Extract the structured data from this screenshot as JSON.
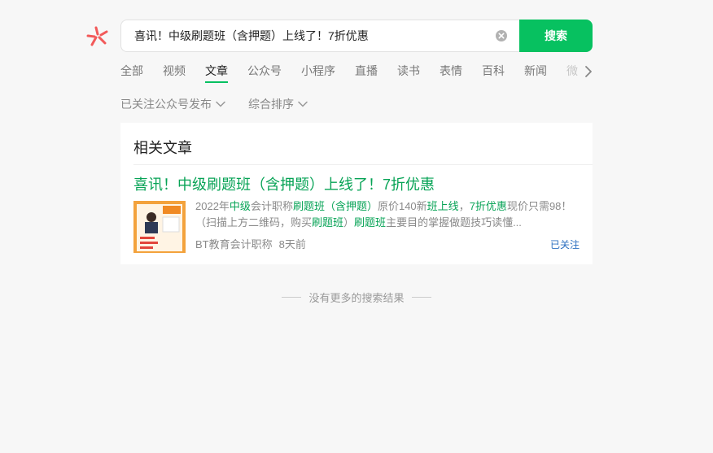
{
  "search": {
    "query": "喜讯！中级刷题班（含押题）上线了！7折优惠",
    "button_label": "搜索"
  },
  "tabs": [
    {
      "label": "全部"
    },
    {
      "label": "视频"
    },
    {
      "label": "文章"
    },
    {
      "label": "公众号"
    },
    {
      "label": "小程序"
    },
    {
      "label": "直播"
    },
    {
      "label": "读书"
    },
    {
      "label": "表情"
    },
    {
      "label": "百科"
    },
    {
      "label": "新闻"
    },
    {
      "label": "微"
    }
  ],
  "active_tab": "文章",
  "filters": [
    {
      "label": "已关注公众号发布"
    },
    {
      "label": "综合排序"
    }
  ],
  "results": {
    "section_title": "相关文章",
    "article": {
      "title": "喜讯！中级刷题班（含押题）上线了！7折优惠",
      "snippet_parts": [
        {
          "text": "2022年",
          "hl": false
        },
        {
          "text": "中级",
          "hl": true
        },
        {
          "text": "会计职称",
          "hl": false
        },
        {
          "text": "刷题班（含押题）",
          "hl": true
        },
        {
          "text": "原价140新",
          "hl": false
        },
        {
          "text": "班上线",
          "hl": true
        },
        {
          "text": "，",
          "hl": false
        },
        {
          "text": "7折优惠",
          "hl": true
        },
        {
          "text": "现价只需98！（扫描上方二维码，购买",
          "hl": false
        },
        {
          "text": "刷题班",
          "hl": true
        },
        {
          "text": "）",
          "hl": false
        },
        {
          "text": "刷题班",
          "hl": true
        },
        {
          "text": "主要目的掌握做题技巧读懂...",
          "hl": false
        }
      ],
      "source": "BT教育会计职称",
      "time": "8天前",
      "follow_status": "已关注"
    }
  },
  "footer": {
    "no_more": "没有更多的搜索结果"
  },
  "colors": {
    "accent": "#07c160",
    "highlight": "#07a356",
    "link_blue": "#2b6fc0",
    "background": "#f7f7f7"
  }
}
